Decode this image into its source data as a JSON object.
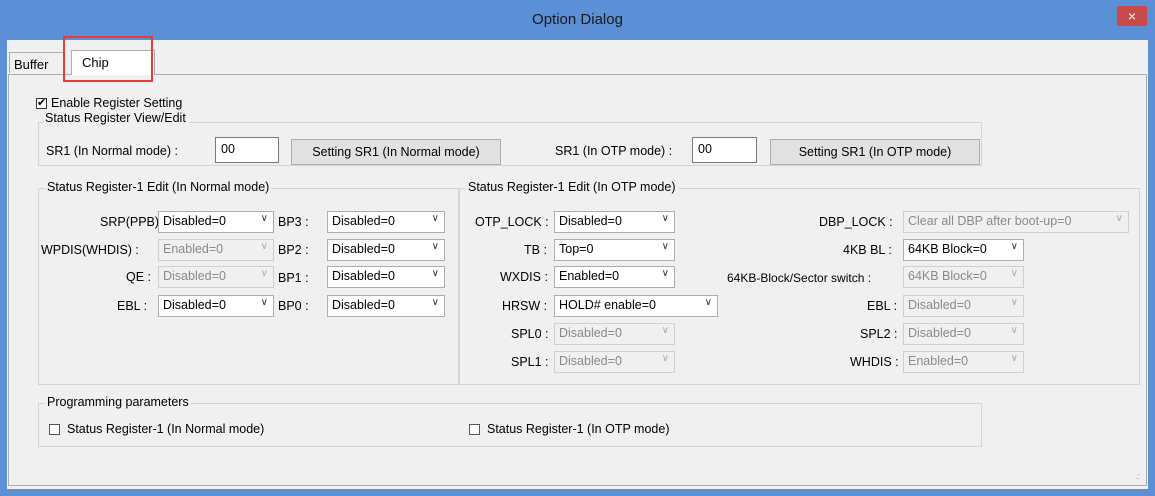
{
  "window": {
    "title": "Option Dialog",
    "close_glyph": "×"
  },
  "tabs": [
    {
      "label": "Buffer"
    },
    {
      "label": "Chip"
    }
  ],
  "enable_register": {
    "label": "Enable Register Setting",
    "checked": true
  },
  "sr_view": {
    "title": "Status Register View/Edit",
    "normal_label": "SR1 (In Normal mode) :",
    "normal_value": "00",
    "normal_button": "Setting SR1 (In Normal mode)",
    "otp_label": "SR1 (In OTP mode) :",
    "otp_value": "00",
    "otp_button": "Setting SR1 (In OTP mode)"
  },
  "normal_edit": {
    "title": "Status Register-1 Edit  (In Normal mode)",
    "rows": [
      {
        "label": "SRP(PPB) :",
        "value": "Disabled=0",
        "enabled": true
      },
      {
        "label": "WPDIS(WHDIS) :",
        "value": "Enabled=0",
        "enabled": false
      },
      {
        "label": "QE :",
        "value": "Disabled=0",
        "enabled": false
      },
      {
        "label": "EBL :",
        "value": "Disabled=0",
        "enabled": true
      }
    ],
    "bp_rows": [
      {
        "label": "BP3 :",
        "value": "Disabled=0"
      },
      {
        "label": "BP2 :",
        "value": "Disabled=0"
      },
      {
        "label": "BP1 :",
        "value": "Disabled=0"
      },
      {
        "label": "BP0 :",
        "value": "Disabled=0"
      }
    ]
  },
  "otp_edit": {
    "title": "Status Register-1 Edit  (In OTP mode)",
    "left_rows": [
      {
        "label": "OTP_LOCK :",
        "value": "Disabled=0",
        "enabled": true
      },
      {
        "label": "TB :",
        "value": "Top=0",
        "enabled": true
      },
      {
        "label": "WXDIS :",
        "value": "Enabled=0",
        "enabled": true
      },
      {
        "label": "HRSW :",
        "value": "HOLD# enable=0",
        "enabled": true
      },
      {
        "label": "SPL0 :",
        "value": "Disabled=0",
        "enabled": false
      },
      {
        "label": "SPL1 :",
        "value": "Disabled=0",
        "enabled": false
      }
    ],
    "right_rows": [
      {
        "label": "DBP_LOCK :",
        "value": "Clear all DBP after boot-up=0",
        "enabled": false
      },
      {
        "label": "4KB BL :",
        "value": "64KB Block=0",
        "enabled": true
      },
      {
        "label": "64KB-Block/Sector switch :",
        "value": "64KB Block=0",
        "enabled": false
      },
      {
        "label": "EBL :",
        "value": "Disabled=0",
        "enabled": false
      },
      {
        "label": "SPL2 :",
        "value": "Disabled=0",
        "enabled": false
      },
      {
        "label": "WHDIS :",
        "value": "Enabled=0",
        "enabled": false
      }
    ]
  },
  "programming": {
    "title": "Programming parameters",
    "normal_label": "Status Register-1 (In Normal mode)",
    "otp_label": "Status Register-1 (In OTP mode)"
  },
  "resize_grip": ".:"
}
